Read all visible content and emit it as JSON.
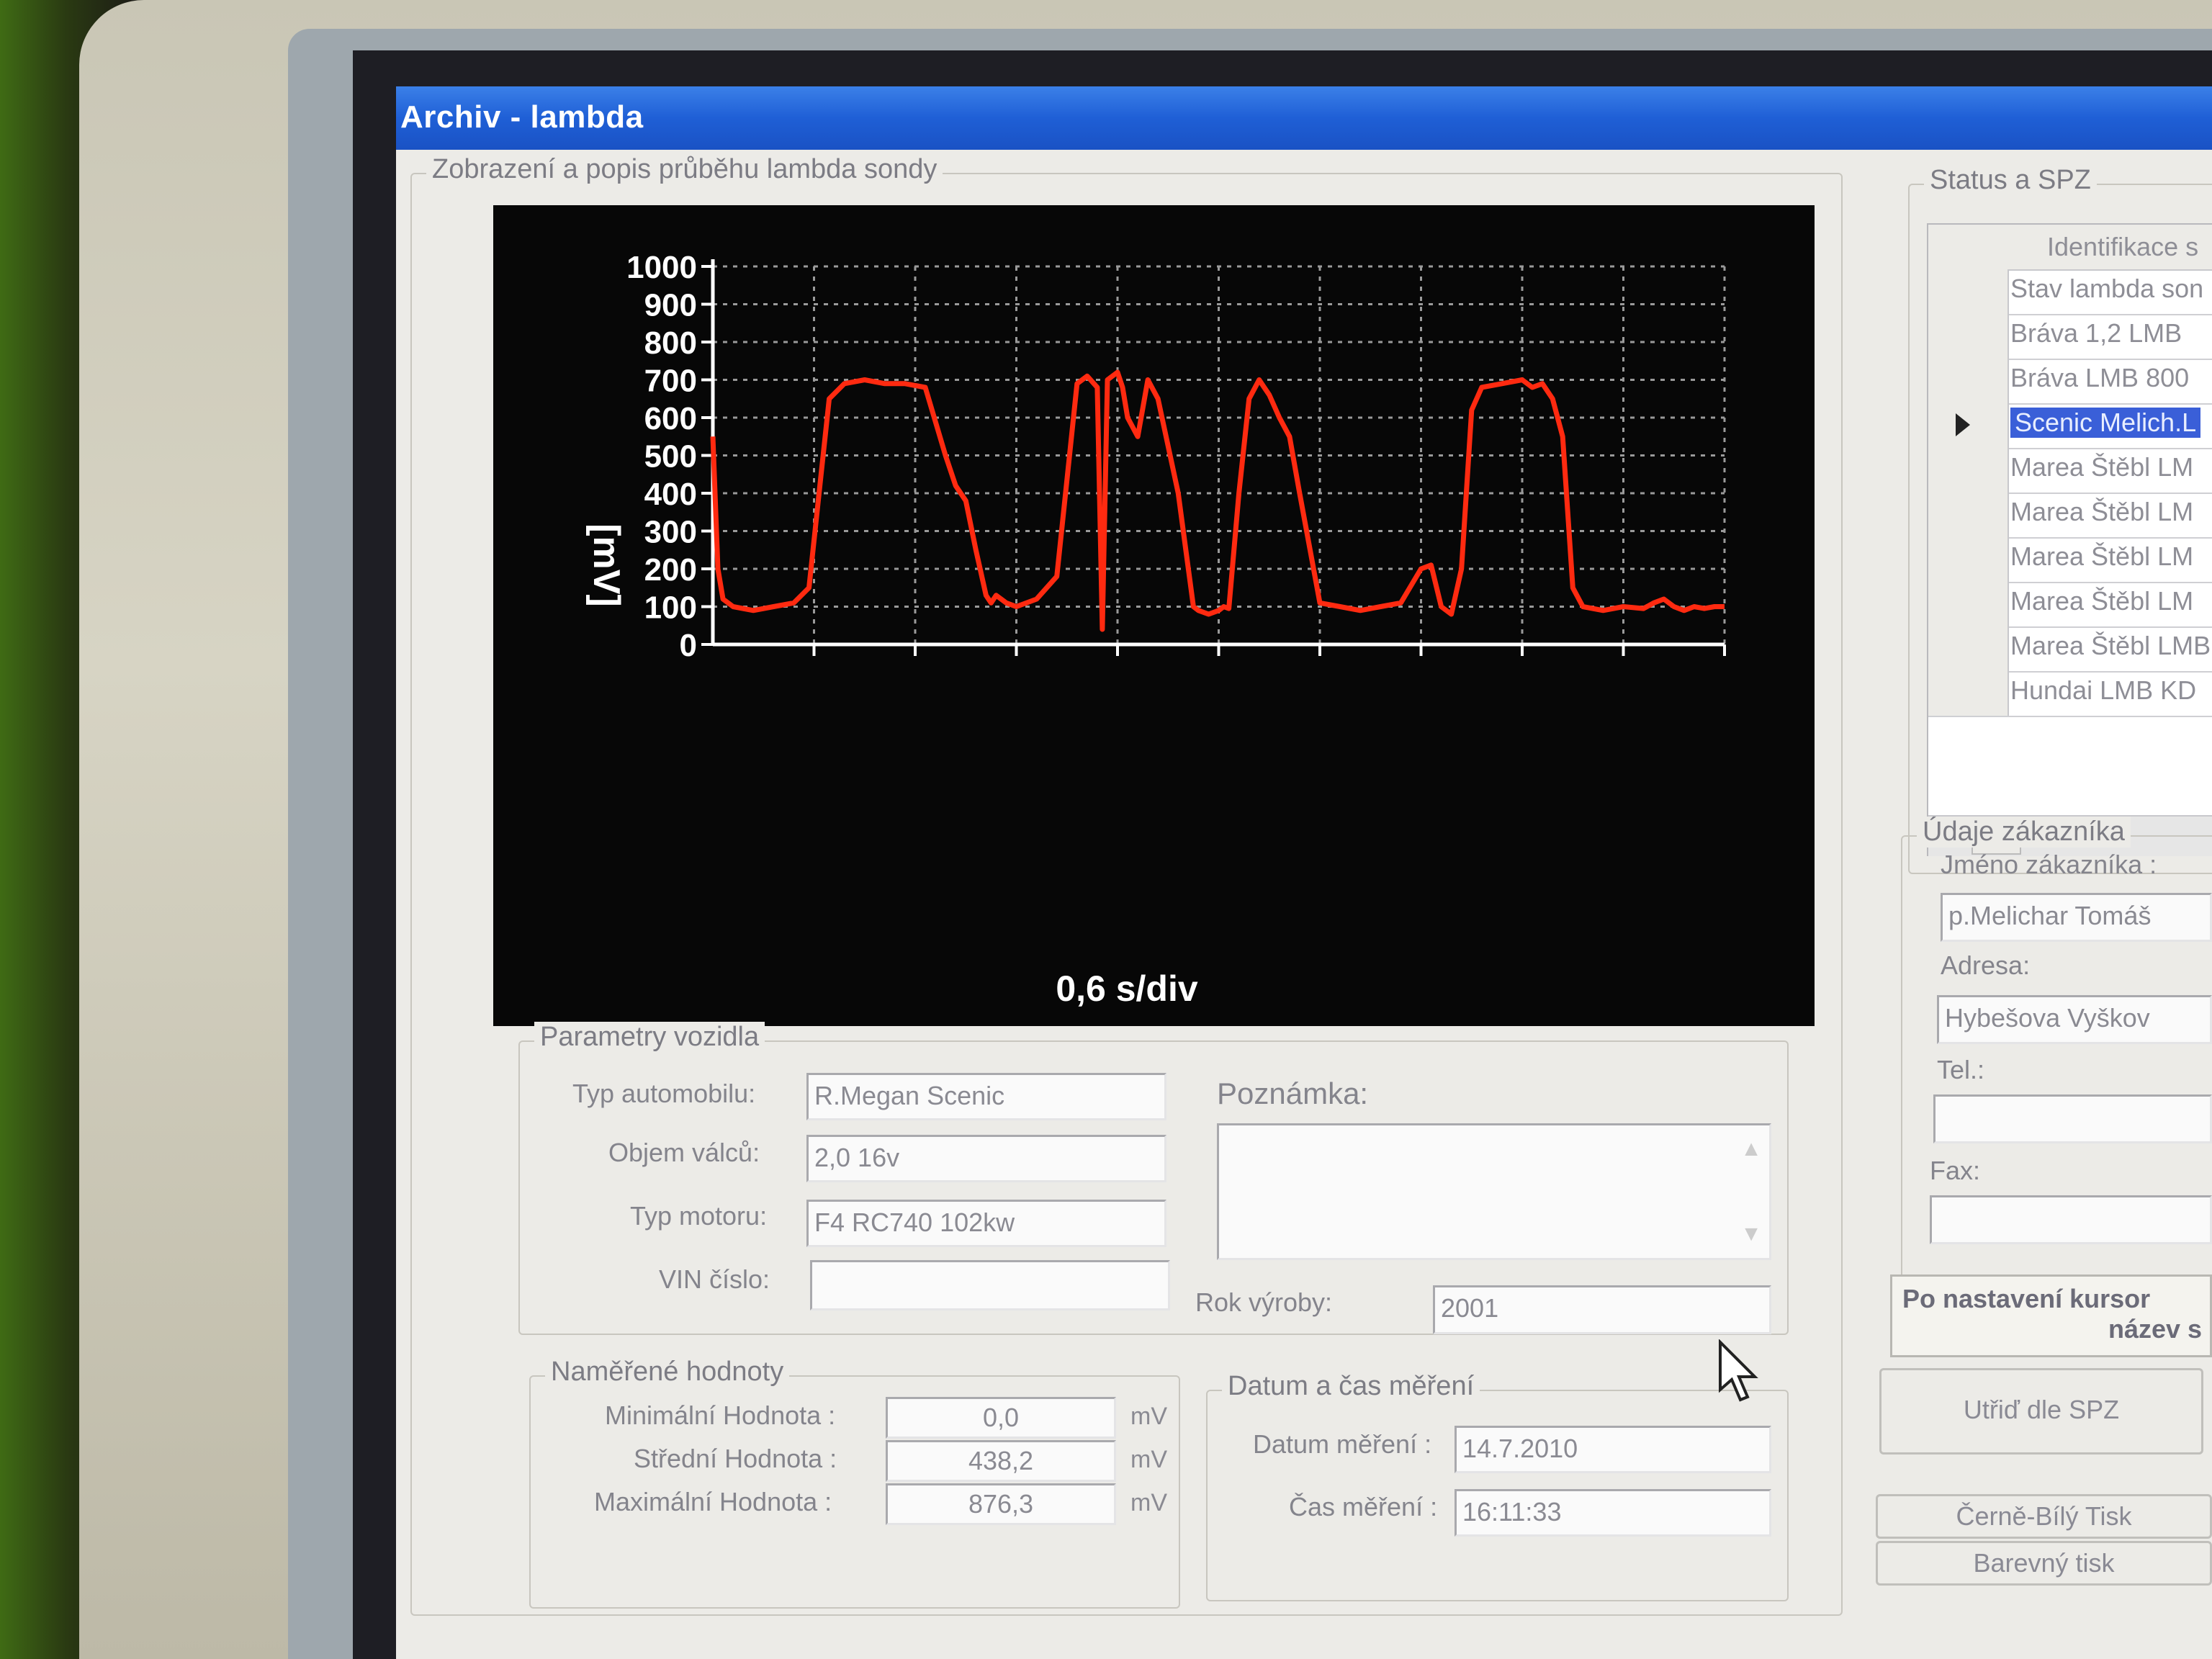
{
  "window": {
    "title": "Archiv - lambda"
  },
  "graph_group": {
    "legend": "Zobrazení a popis průběhu lambda sondy"
  },
  "chart_data": {
    "type": "line",
    "ylabel": "[mV]",
    "xlabel": "0,6 s/div",
    "ylim": [
      0,
      1000
    ],
    "y_ticks": [
      "1000",
      "900",
      "800",
      "700",
      "600",
      "500",
      "400",
      "300",
      "200",
      "100",
      "0"
    ],
    "x_divisions": 10,
    "grid": true,
    "line_color": "#ff2a10",
    "series": [
      {
        "x": [
          0,
          0.05,
          0.1,
          0.2,
          0.4,
          0.6,
          0.8,
          0.95,
          1.05,
          1.15,
          1.3,
          1.5,
          1.7,
          1.9,
          2.1,
          2.3,
          2.4,
          2.5,
          2.6,
          2.7,
          2.75,
          2.8,
          2.9,
          3.0,
          3.2,
          3.4,
          3.6,
          3.7,
          3.8,
          3.85,
          3.9,
          4.0,
          4.05,
          4.1,
          4.2,
          4.3,
          4.4,
          4.6,
          4.75,
          4.8,
          4.9,
          5.0,
          5.05,
          5.1,
          5.2,
          5.3,
          5.4,
          5.45,
          5.5,
          5.6,
          5.7,
          5.8,
          6.0,
          6.2,
          6.4,
          6.6,
          6.8,
          7.0,
          7.1,
          7.2,
          7.3,
          7.4,
          7.5,
          7.6,
          7.8,
          8.0,
          8.1,
          8.2,
          8.3,
          8.4,
          8.5,
          8.6,
          8.8,
          9.0,
          9.2,
          9.3,
          9.4,
          9.5,
          9.6,
          9.7,
          9.8,
          9.9,
          10.0
        ],
        "y": [
          550,
          200,
          120,
          100,
          90,
          100,
          110,
          150,
          400,
          650,
          690,
          700,
          690,
          690,
          680,
          500,
          420,
          380,
          250,
          130,
          110,
          130,
          110,
          100,
          120,
          180,
          690,
          710,
          680,
          40,
          700,
          720,
          680,
          600,
          550,
          700,
          650,
          400,
          100,
          90,
          80,
          90,
          100,
          95,
          400,
          650,
          700,
          680,
          660,
          600,
          550,
          400,
          110,
          100,
          90,
          100,
          110,
          200,
          210,
          100,
          80,
          200,
          620,
          680,
          690,
          700,
          680,
          690,
          650,
          550,
          150,
          100,
          90,
          100,
          95,
          110,
          120,
          100,
          90,
          100,
          95,
          100,
          100
        ]
      }
    ]
  },
  "vehicle": {
    "legend": "Parametry vozidla",
    "type_label": "Typ automobilu:",
    "type_value": "R.Megan Scenic",
    "volume_label": "Objem válců:",
    "volume_value": "2,0 16v",
    "engine_label": "Typ motoru:",
    "engine_value": "F4 RC740   102kw",
    "vin_label": "VIN číslo:",
    "vin_value": "",
    "note_label": "Poznámka:",
    "year_label": "Rok výroby:",
    "year_value": "2001"
  },
  "measured": {
    "legend": "Naměřené hodnoty",
    "min_label": "Minimální Hodnota :",
    "min_value": "0,0",
    "mid_label": "Střední Hodnota :",
    "mid_value": "438,2",
    "max_label": "Maximální Hodnota :",
    "max_value": "876,3",
    "unit": "mV"
  },
  "datetime": {
    "legend": "Datum a čas měření",
    "date_label": "Datum měření :",
    "date_value": "14.7.2010",
    "time_label": "Čas měření :",
    "time_value": "16:11:33"
  },
  "status": {
    "legend": "Status a SPZ",
    "col_header": "Identifikace s",
    "rows": [
      "Stav lambda son",
      "Bráva 1,2 LMB",
      "Bráva LMB 800",
      "Scenic Melich.L",
      "Marea Štěbl LM",
      "Marea Štěbl LM",
      "Marea Štěbl LM",
      "Marea Štěbl LM",
      "Marea Štěbl LMB",
      "Hundai LMB KD"
    ],
    "selected_index": 3
  },
  "customer": {
    "legend": "Údaje zákazníka",
    "name_label": "Jméno zákazníka :",
    "name_value": "p.Melichar Tomáš",
    "address_label": "Adresa:",
    "address_value": "Hybešova Vyškov",
    "tel_label": "Tel.:",
    "tel_value": "",
    "fax_label": "Fax:",
    "fax_value": ""
  },
  "hint": {
    "line1": "Po nastavení kursor",
    "line2": "název s"
  },
  "buttons": {
    "sort": "Utřiď dle SPZ",
    "bw_print": "Černě-Bílý Tisk",
    "color_print": "Barevný tisk"
  }
}
